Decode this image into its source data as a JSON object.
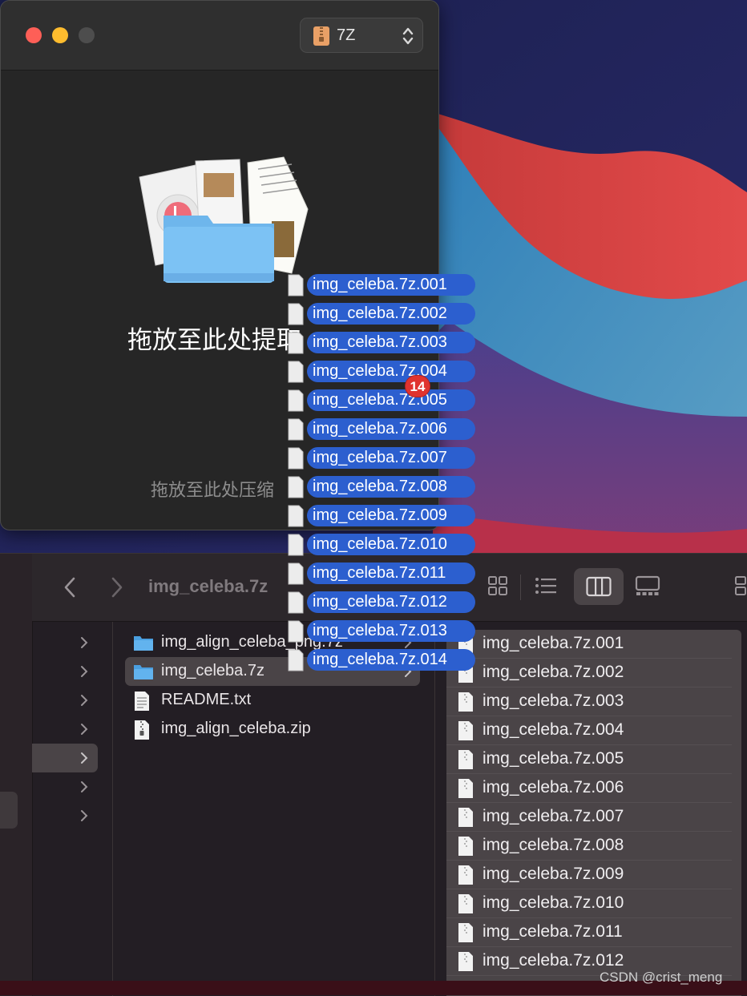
{
  "colors": {
    "accent": "#2c5fcf",
    "badge": "#e0332f",
    "window_bg": "#262626",
    "finder_selection": "#4a4447"
  },
  "archiver": {
    "format_label": "7Z",
    "format_icon": "zip-archive-icon",
    "drop_extract_text": "拖放至此处提取",
    "drop_compress_text": "拖放至此处压缩"
  },
  "finder": {
    "title": "img_celeba.7z",
    "toolbar_icons": [
      "back-chevron-icon",
      "forward-chevron-icon",
      "icon-view-icon",
      "list-view-icon",
      "column-view-icon",
      "gallery-view-icon",
      "group-icon"
    ],
    "column2": [
      {
        "label": "img_align_celeba_png.7z",
        "icon": "folder-icon",
        "selected": false
      },
      {
        "label": "img_celeba.7z",
        "icon": "folder-icon",
        "selected": true
      },
      {
        "label": "README.txt",
        "icon": "text-file-icon",
        "selected": false
      },
      {
        "label": "img_align_celeba.zip",
        "icon": "zip-file-icon",
        "selected": false
      }
    ],
    "column3": [
      "img_celeba.7z.001",
      "img_celeba.7z.002",
      "img_celeba.7z.003",
      "img_celeba.7z.004",
      "img_celeba.7z.005",
      "img_celeba.7z.006",
      "img_celeba.7z.007",
      "img_celeba.7z.008",
      "img_celeba.7z.009",
      "img_celeba.7z.010",
      "img_celeba.7z.011",
      "img_celeba.7z.012"
    ]
  },
  "drag": {
    "count": "14",
    "items": [
      "img_celeba.7z.001",
      "img_celeba.7z.002",
      "img_celeba.7z.003",
      "img_celeba.7z.004",
      "img_celeba.7z.005",
      "img_celeba.7z.006",
      "img_celeba.7z.007",
      "img_celeba.7z.008",
      "img_celeba.7z.009",
      "img_celeba.7z.010",
      "img_celeba.7z.011",
      "img_celeba.7z.012",
      "img_celeba.7z.013",
      "img_celeba.7z.014"
    ]
  },
  "watermark": "CSDN @crist_meng"
}
